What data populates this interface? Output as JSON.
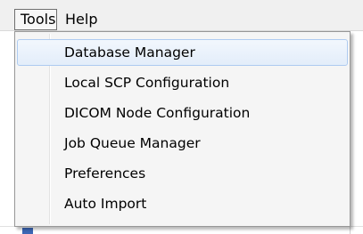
{
  "menubar": {
    "tools_label": "Tools",
    "help_label": "Help"
  },
  "dropdown": {
    "items": [
      {
        "label": "Database Manager",
        "hovered": true
      },
      {
        "label": "Local SCP Configuration"
      },
      {
        "label": "DICOM Node Configuration"
      },
      {
        "label": "Job Queue Manager"
      },
      {
        "label": "Preferences"
      },
      {
        "label": "Auto Import"
      }
    ]
  },
  "colors": {
    "menubar_bg": "#f0f0f0",
    "dropdown_bg": "#f5f5f5",
    "hover_border": "#aecbf0",
    "hover_fill": "#e3edfa"
  }
}
